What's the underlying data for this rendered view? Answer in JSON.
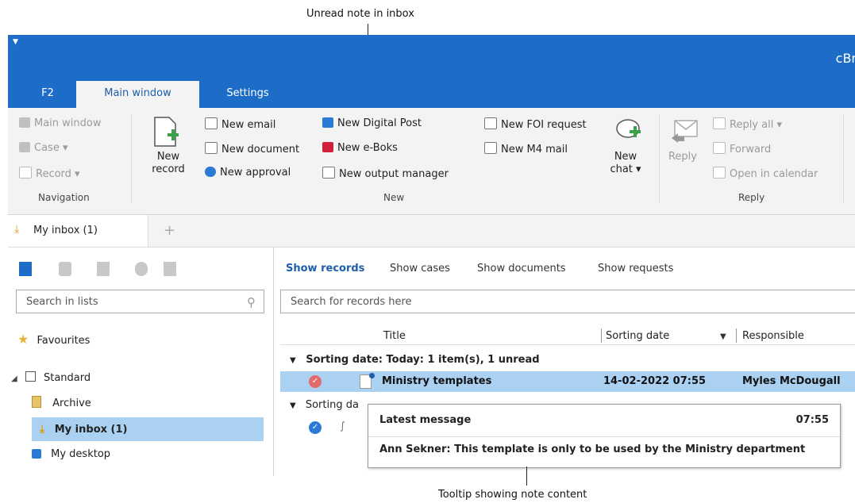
{
  "annotations": {
    "top": "Unread note in inbox",
    "bottom": "Tooltip showing note content"
  },
  "app": {
    "title": "cBr",
    "tabs": [
      "F2",
      "Main window",
      "Settings"
    ],
    "active_tab": "Main window"
  },
  "ribbon": {
    "navigation": {
      "items": [
        "Main window",
        "Case ▾",
        "Record ▾"
      ],
      "label": "Navigation"
    },
    "new": {
      "new_record": "New record",
      "col1": [
        "New email",
        "New document",
        "New approval"
      ],
      "col2": [
        "New Digital Post",
        "New e-Boks",
        "New output manager"
      ],
      "col3": [
        "New FOI request",
        "New M4 mail"
      ],
      "new_chat": "New chat ▾",
      "label": "New"
    },
    "reply": {
      "reply": "Reply",
      "items": [
        "Reply all ▾",
        "Forward",
        "Open in calendar"
      ],
      "label": "Reply"
    }
  },
  "doc_tabs": {
    "active": "My inbox (1)",
    "add": "+"
  },
  "sidebar": {
    "search_placeholder": "Search in lists",
    "favourites": "Favourites",
    "standard": "Standard",
    "items": [
      "Archive",
      "My inbox (1)",
      "My desktop"
    ]
  },
  "main": {
    "tabs": [
      "Show records",
      "Show cases",
      "Show documents",
      "Show requests"
    ],
    "search_placeholder": "Search for records here",
    "columns": [
      "Title",
      "Sorting date",
      "Responsible"
    ],
    "group1": "Sorting date: Today: 1 item(s), 1 unread",
    "row": {
      "title": "Ministry templates",
      "date": "14-02-2022 07:55",
      "responsible": "Myles McDougall"
    },
    "group2": "Sorting da"
  },
  "tooltip": {
    "header": "Latest message",
    "time": "07:55",
    "body": "Ann Sekner: This template is only to be used by the Ministry department"
  },
  "colors": {
    "brand": "#1d6cc8",
    "selection": "#aad0f2",
    "ribbon_bg": "#f3f3f3"
  }
}
